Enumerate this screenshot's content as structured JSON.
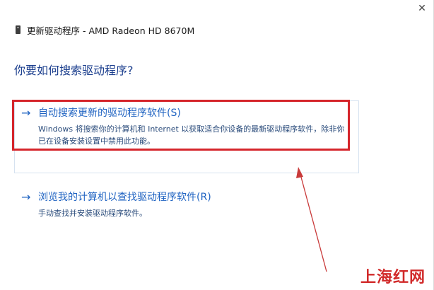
{
  "window": {
    "close_glyph": "✕",
    "title": "更新驱动程序 - AMD Radeon HD 8670M"
  },
  "heading": "你要如何搜索驱动程序?",
  "options": [
    {
      "arrow": "→",
      "title": "自动搜索更新的驱动程序软件(S)",
      "description": "Windows 将搜索你的计算机和 Internet 以获取适合你设备的最新驱动程序软件，除非你已在设备安装设置中禁用此功能。"
    },
    {
      "arrow": "→",
      "title": "浏览我的计算机以查找驱动程序软件(R)",
      "description": "手动查找并安装驱动程序软件。"
    }
  ],
  "annotation": {
    "highlight_color": "#d5252b",
    "arrow_color": "#c93a3a"
  },
  "watermark": "上海红网",
  "colors": {
    "heading": "#1c3f8e",
    "link": "#1f63c2",
    "description": "#2c4d7c"
  },
  "icons": {
    "device": "device-icon",
    "close": "close-icon"
  }
}
